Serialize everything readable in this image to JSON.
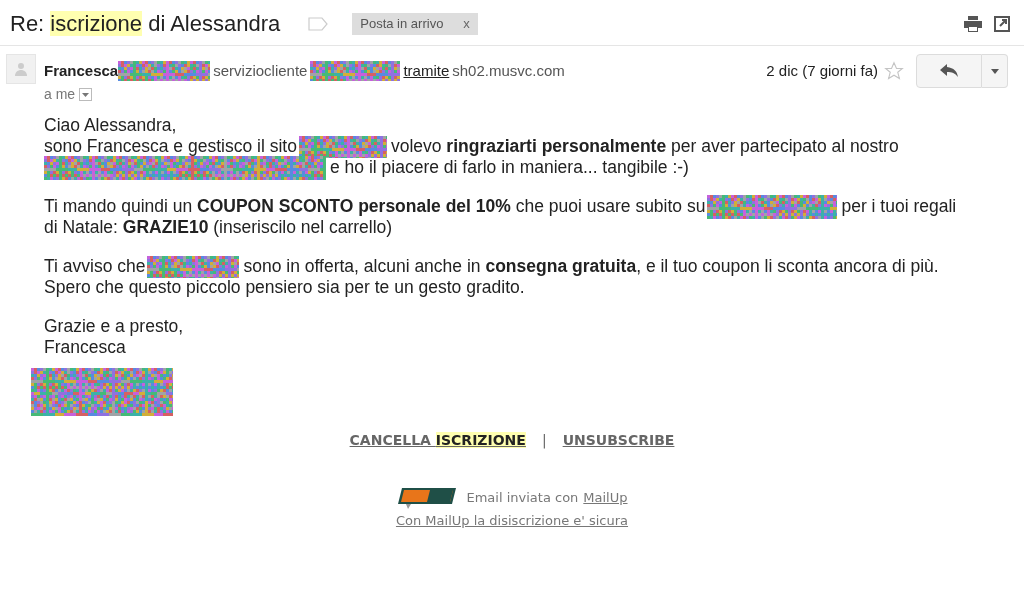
{
  "subject": [
    {
      "text": "Re: ",
      "highlight": false
    },
    {
      "text": "iscrizione",
      "highlight": true
    },
    {
      "text": " di Alessandra",
      "highlight": false
    }
  ],
  "label": {
    "text": "Posta in arrivo",
    "remove": "x"
  },
  "sender": {
    "name": "Francesca",
    "parts": [
      {
        "kind": "redacted"
      },
      {
        "kind": "text",
        "text": "serviziocliente"
      },
      {
        "kind": "redacted"
      },
      {
        "kind": "link",
        "text": "tramite"
      },
      {
        "kind": "text",
        "text": "sh02.musvc.com"
      }
    ],
    "recipient": "a me",
    "date": "2 dic (7 giorni fa)",
    "starred": false
  },
  "body": [
    [
      [
        {
          "kind": "text",
          "text": "Ciao Alessandra,"
        }
      ],
      [
        {
          "kind": "text",
          "text": "sono Francesca e gestisco il sito"
        },
        {
          "kind": "redacted"
        },
        {
          "kind": "text",
          "text": "volevo **ringraziarti personalmente** per aver partecipato al nostro"
        }
      ],
      [
        {
          "kind": "redacted"
        },
        {
          "kind": "text",
          "text": "e ho il piacere di farlo in maniera... tangibile :-)"
        }
      ]
    ],
    [
      [
        {
          "kind": "text",
          "text": "Ti mando quindi un **COUPON SCONTO personale del 10%** che puoi usare subito su"
        },
        {
          "kind": "redacted"
        },
        {
          "kind": "text",
          "text": "per i tuoi regali"
        }
      ],
      [
        {
          "kind": "text",
          "text": "di Natale: **GRAZIE10** (inseriscilo nel carrello)"
        }
      ]
    ],
    [
      [
        {
          "kind": "text",
          "text": "Ti avviso che"
        },
        {
          "kind": "redacted"
        },
        {
          "kind": "text",
          "text": "sono in offerta, alcuni anche in **consegna gratuita**, e il tuo coupon li sconta ancora di più."
        }
      ],
      [
        {
          "kind": "text",
          "text": "Spero che questo piccolo pensiero sia per te un gesto gradito."
        }
      ]
    ],
    [
      [
        {
          "kind": "text",
          "text": "Grazie e a presto,"
        }
      ],
      [
        {
          "kind": "text",
          "text": "Francesca"
        }
      ]
    ]
  ],
  "footer": {
    "links": [
      [
        {
          "text": "CANCELLA ",
          "highlight": false
        },
        {
          "text": "ISCRIZIONE",
          "highlight": true
        }
      ],
      [
        {
          "text": "UNSUBSCRIBE",
          "highlight": false
        }
      ]
    ],
    "separator": "|",
    "sent_with": "Email inviata con",
    "sent_link": "MailUp",
    "safe_link": "Con MailUp la disiscrizione e' sicura"
  }
}
